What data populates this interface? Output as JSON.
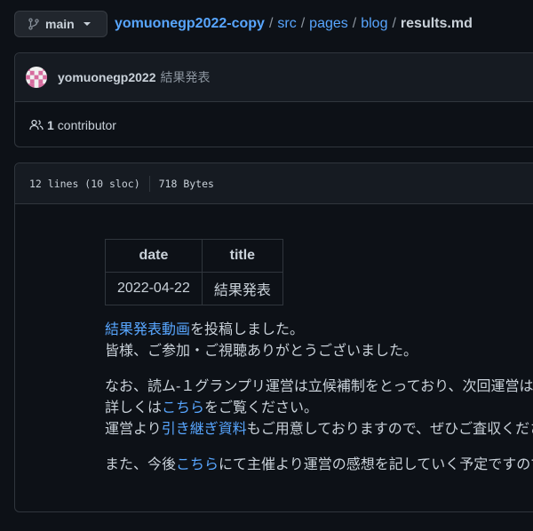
{
  "branch": {
    "icon": "git-branch-icon",
    "label": "main"
  },
  "breadcrumb": {
    "repo": "yomuonegp2022-copy",
    "sep": "/",
    "parts": [
      "src",
      "pages",
      "blog"
    ],
    "file": "results.md"
  },
  "commit": {
    "avatar": "identicon-avatar",
    "author": "yomuonegp2022",
    "message": "結果発表"
  },
  "contributors": {
    "icon": "people-icon",
    "count": "1",
    "label": "contributor"
  },
  "file_info": {
    "lines": "12 lines (10 sloc)",
    "size": "718 Bytes"
  },
  "frontmatter": {
    "headers": [
      "date",
      "title"
    ],
    "row": [
      "2022-04-22",
      "結果発表"
    ]
  },
  "content": {
    "p1": {
      "link1": "結果発表動画",
      "text1": "を投稿しました。",
      "line2": "皆様、ご参加・ご視聴ありがとうございました。"
    },
    "p2": {
      "line1": "なお、読ム-１グランプリ運営は立候補制をとっており、次回運営は",
      "line2_pre": "詳しくは",
      "line2_link": "こちら",
      "line2_post": "をご覧ください。",
      "line3_pre": "運営より",
      "line3_link": "引き継ぎ資料",
      "line3_post": "もご用意しておりますので、ぜひご査収くださ"
    },
    "p3": {
      "pre": "また、今後",
      "link": "こちら",
      "post": "にて主催より運営の感想を記していく予定ですので"
    }
  },
  "colors": {
    "background": "#0d1117",
    "panel": "#161b22",
    "border": "#30363d",
    "link": "#58a6ff",
    "text": "#c9d1d9",
    "muted": "#8b949e"
  }
}
